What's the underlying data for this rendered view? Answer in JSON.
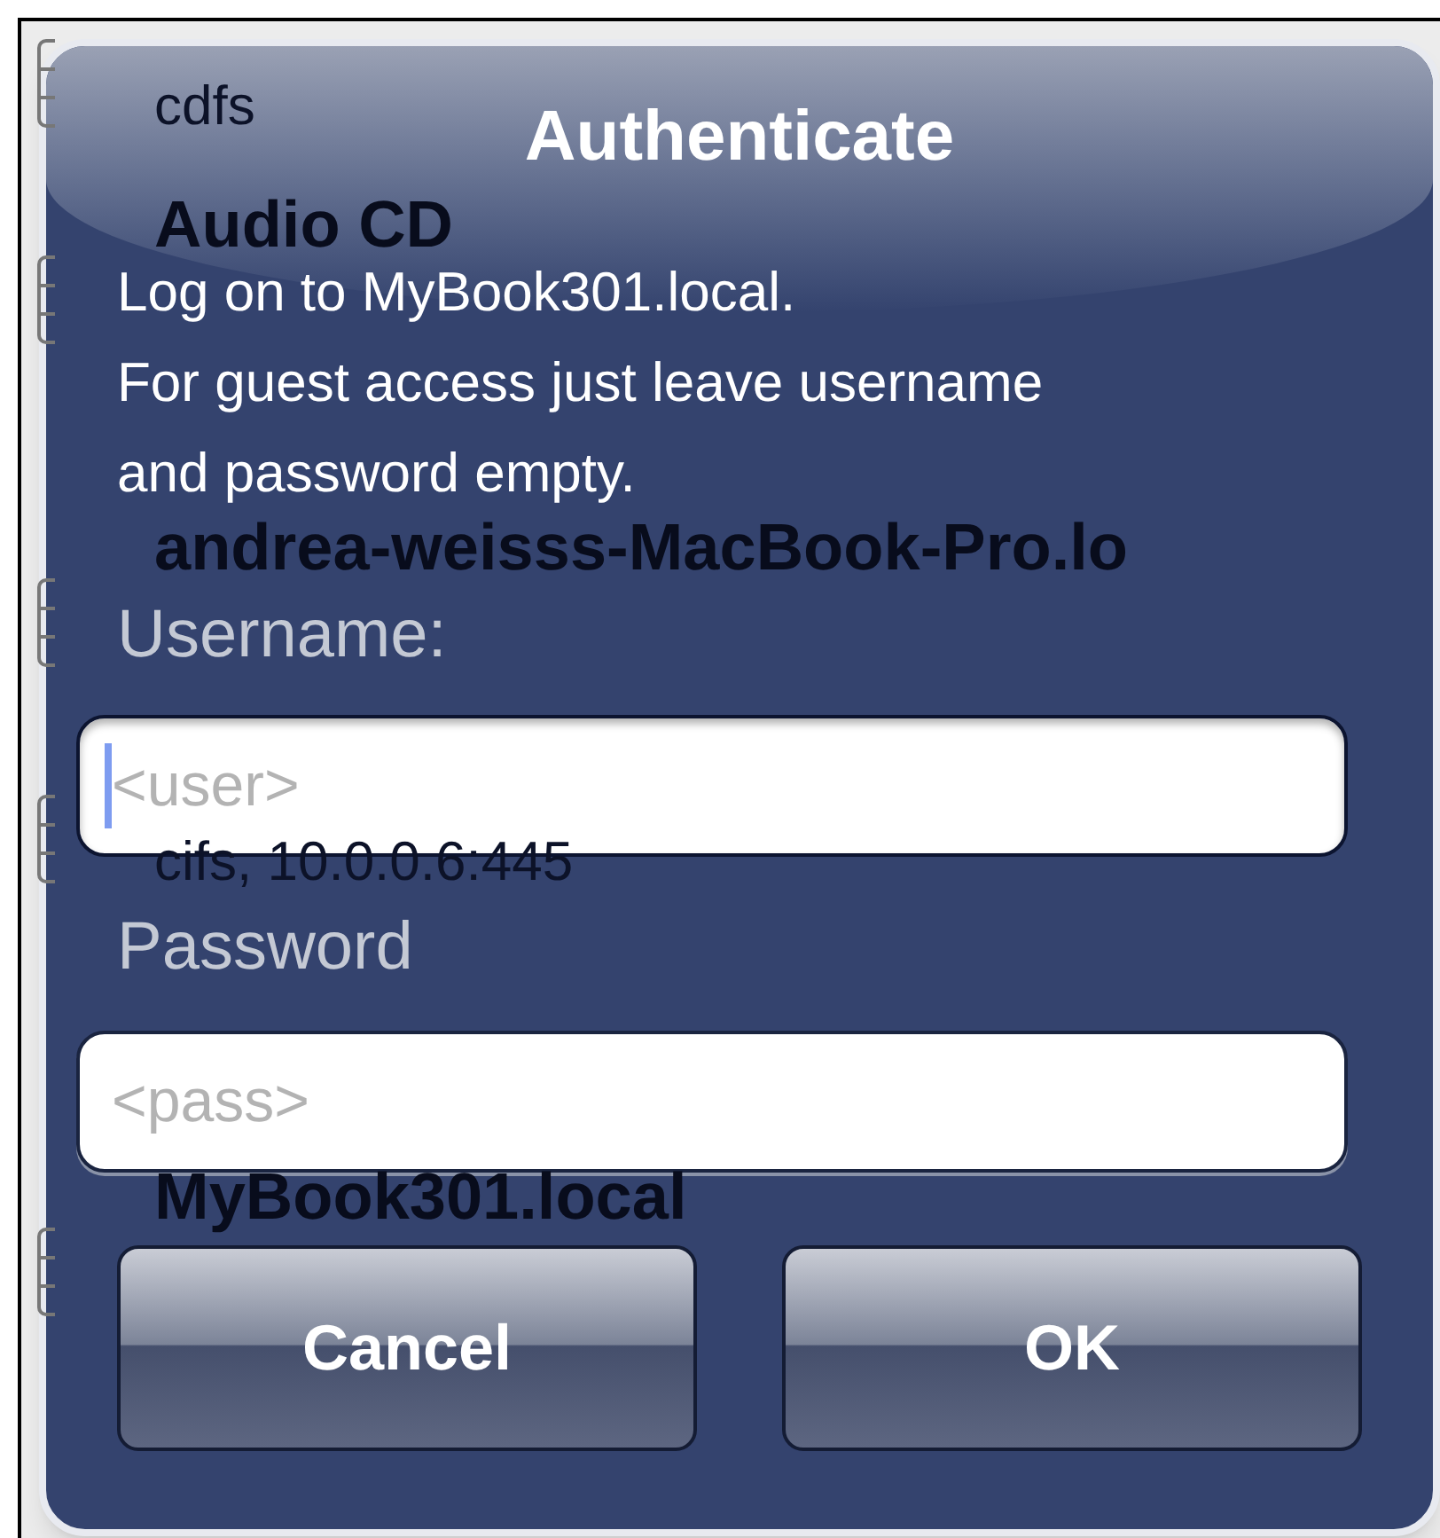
{
  "background_sections": [
    {
      "items": [
        {
          "subtitle": "cdfs"
        },
        {
          "title": "Audio CD"
        }
      ]
    },
    {
      "items": [
        {
          "title": "andrea-weisss-MacBook-Pro.lo"
        },
        {
          "subtitle": "cifs, 10.0.0.6:445"
        }
      ]
    },
    {
      "items": [
        {
          "title": "MyBook301.local"
        }
      ]
    }
  ],
  "dialog": {
    "title": "Authenticate",
    "message": [
      "Log on to MyBook301.local.",
      "For guest access just leave username",
      "and password empty."
    ],
    "fields": [
      {
        "label": "Username:",
        "placeholder": "<user>",
        "focused": true
      },
      {
        "label": "Password",
        "placeholder": "<pass>",
        "focused": false
      }
    ],
    "buttons": [
      "Cancel",
      "OK"
    ]
  }
}
